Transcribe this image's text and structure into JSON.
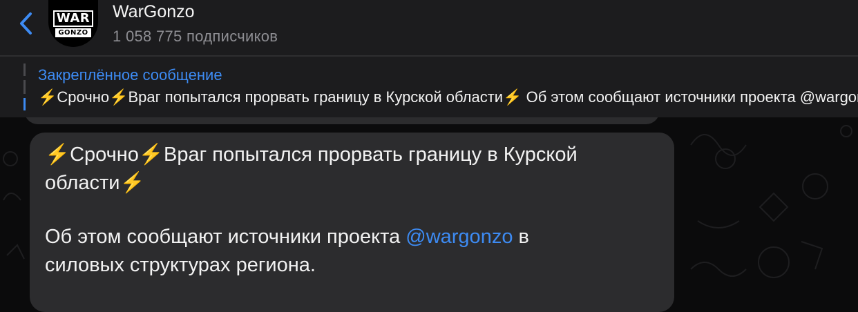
{
  "header": {
    "channel_name": "WarGonzo",
    "subscribers": "1 058 775 подписчиков",
    "avatar_logo_top": "WAR",
    "avatar_logo_bottom": "GONZO"
  },
  "pinned": {
    "label": "Закреплённое сообщение",
    "preview": "⚡️Срочно⚡️Враг попытался прорвать границу в Курской области⚡️  Об этом сообщают источники проекта @wargonzo в силовых структурах региона."
  },
  "message": {
    "line1": "⚡️Срочно⚡️Враг попытался прорвать границу в Курской",
    "line2": "области⚡️",
    "line3_before": "Об этом сообщают источники проекта ",
    "mention": "@wargonzo",
    "line3_after": " в",
    "line4": "силовых структурах региона."
  },
  "colors": {
    "accent": "#3d8bf3",
    "header_bg": "#1c1c1e",
    "bubble_bg": "#2c2c2e",
    "chat_bg": "#0b0b0c",
    "secondary_text": "#8e8e93"
  },
  "icons": {
    "back": "chevron-left-icon"
  }
}
